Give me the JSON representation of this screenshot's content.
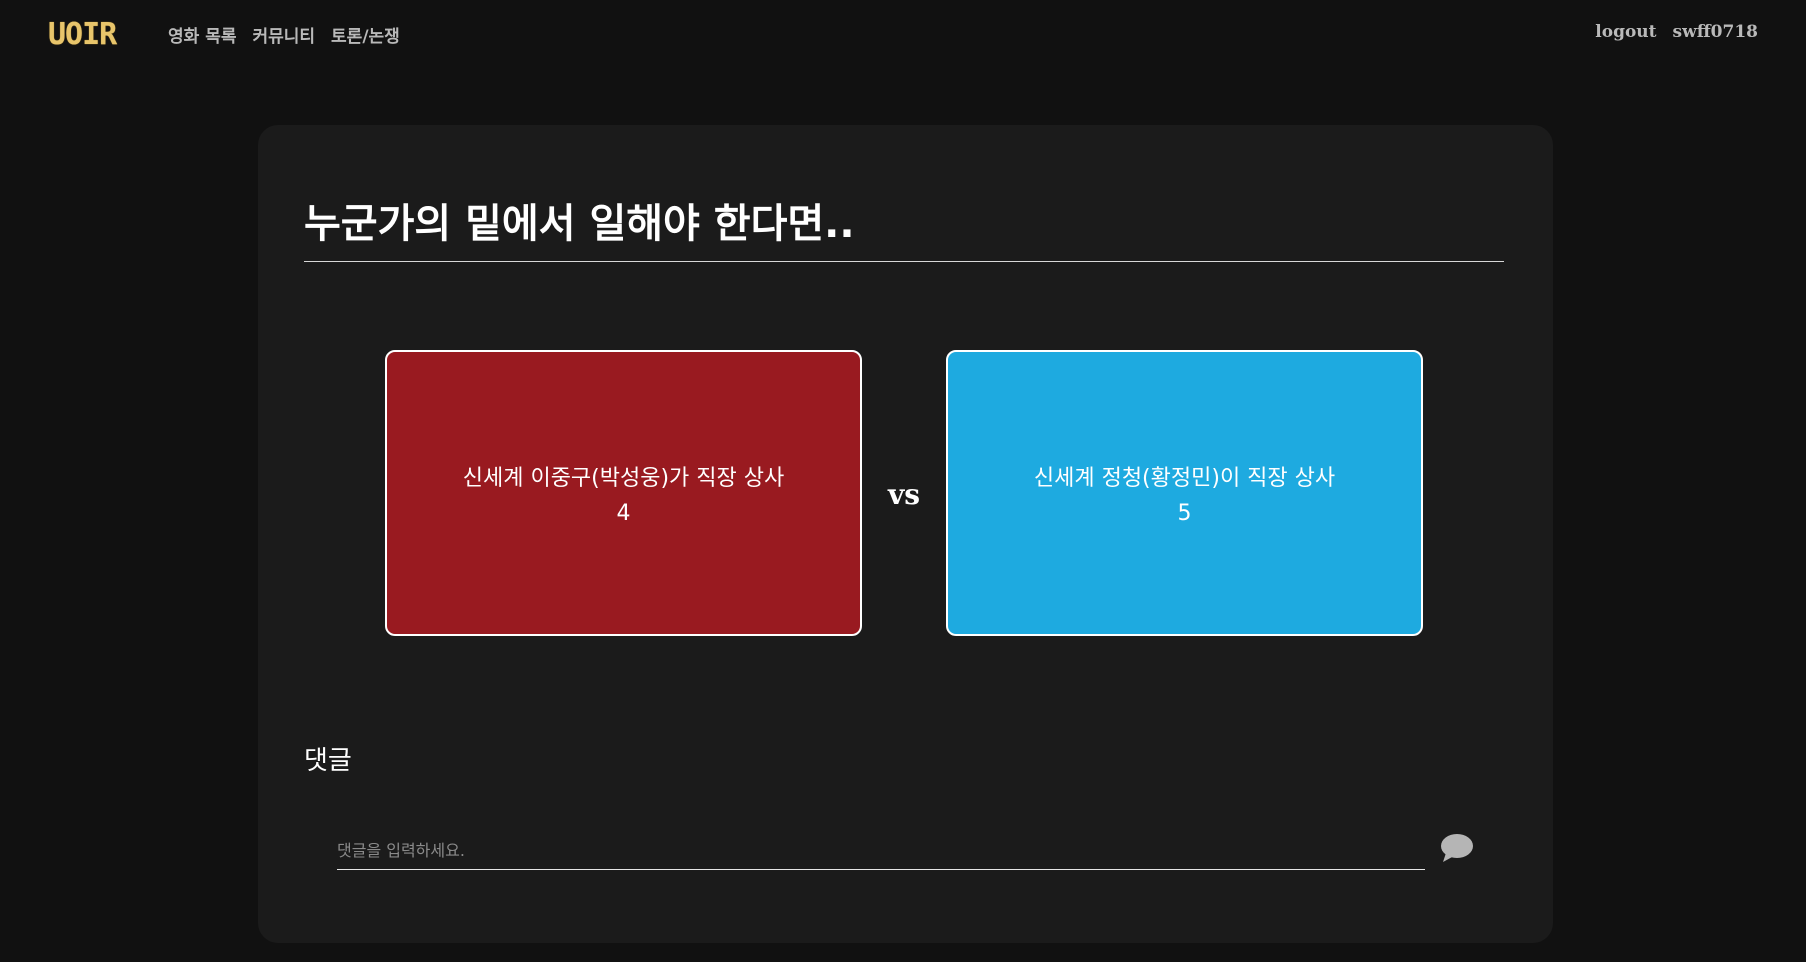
{
  "brand": {
    "logo_text": "UOIR",
    "logo_color": "#e8c56b"
  },
  "nav": {
    "links": [
      "영화 목록",
      "커뮤니티",
      "토론/논쟁"
    ],
    "right": [
      "logout",
      "swff0718"
    ]
  },
  "debate": {
    "title": "누군가의 밑에서 일해야 한다면..",
    "vs_label": "vs",
    "option_a": {
      "label": "신세계 이중구(박성웅)가 직장 상사",
      "votes": "4",
      "color": "#991a20"
    },
    "option_b": {
      "label": "신세계 정청(황정민)이 직장 상사",
      "votes": "5",
      "color": "#1eaae0"
    }
  },
  "comments": {
    "heading": "댓글",
    "placeholder": "댓글을 입력하세요.",
    "send_icon": "speech-bubble-icon"
  },
  "colors": {
    "background": "#111111",
    "card": "#1b1b1b",
    "nav_text": "#b9b9b9"
  }
}
